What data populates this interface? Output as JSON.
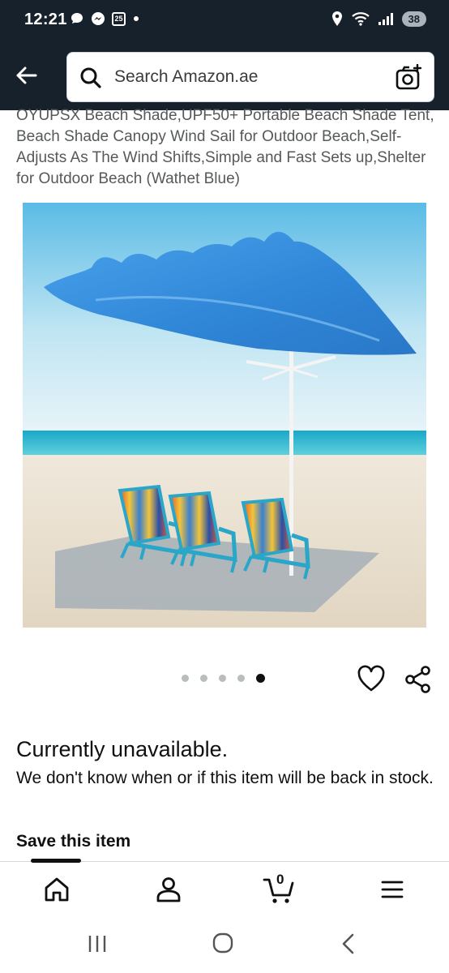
{
  "status_bar": {
    "time": "12:21",
    "calendar_day": "25",
    "battery": "38",
    "icons": [
      "chat-bubble-icon",
      "messenger-icon",
      "calendar-icon",
      "dot-icon",
      "location-icon",
      "wifi-icon",
      "signal-icon",
      "battery-icon"
    ]
  },
  "header": {
    "search_placeholder": "Search Amazon.ae",
    "icons": [
      "back-arrow-icon",
      "search-icon",
      "camera-icon"
    ]
  },
  "product": {
    "title": "OYUPSX Beach Shade,UPF50+ Portable Beach Shade Tent, Beach Shade Canopy Wind Sail for Outdoor Beach,Self-Adjusts As The Wind Shifts,Simple and Fast Sets up,Shelter for Outdoor Beach (Wathet Blue)",
    "image_alt": "Blue wind sail beach shade over three striped beach chairs on sand",
    "carousel": {
      "total": 5,
      "active_index": 5
    }
  },
  "availability": {
    "title": "Currently unavailable.",
    "text": "We don't know when or if this item will be back in stock."
  },
  "save_item_label": "Save this item",
  "bottom_nav": {
    "items": [
      "home-icon",
      "account-icon",
      "cart-icon",
      "menu-icon"
    ],
    "cart_count": "0"
  },
  "system_nav": {
    "items": [
      "recents-icon",
      "home-circle-icon",
      "back-chevron-icon"
    ]
  },
  "colors": {
    "header_bg": "#17212b",
    "canopy_blue": "#3d8fdb",
    "sea": "#2fb6d0",
    "sand": "#ece4d6"
  }
}
